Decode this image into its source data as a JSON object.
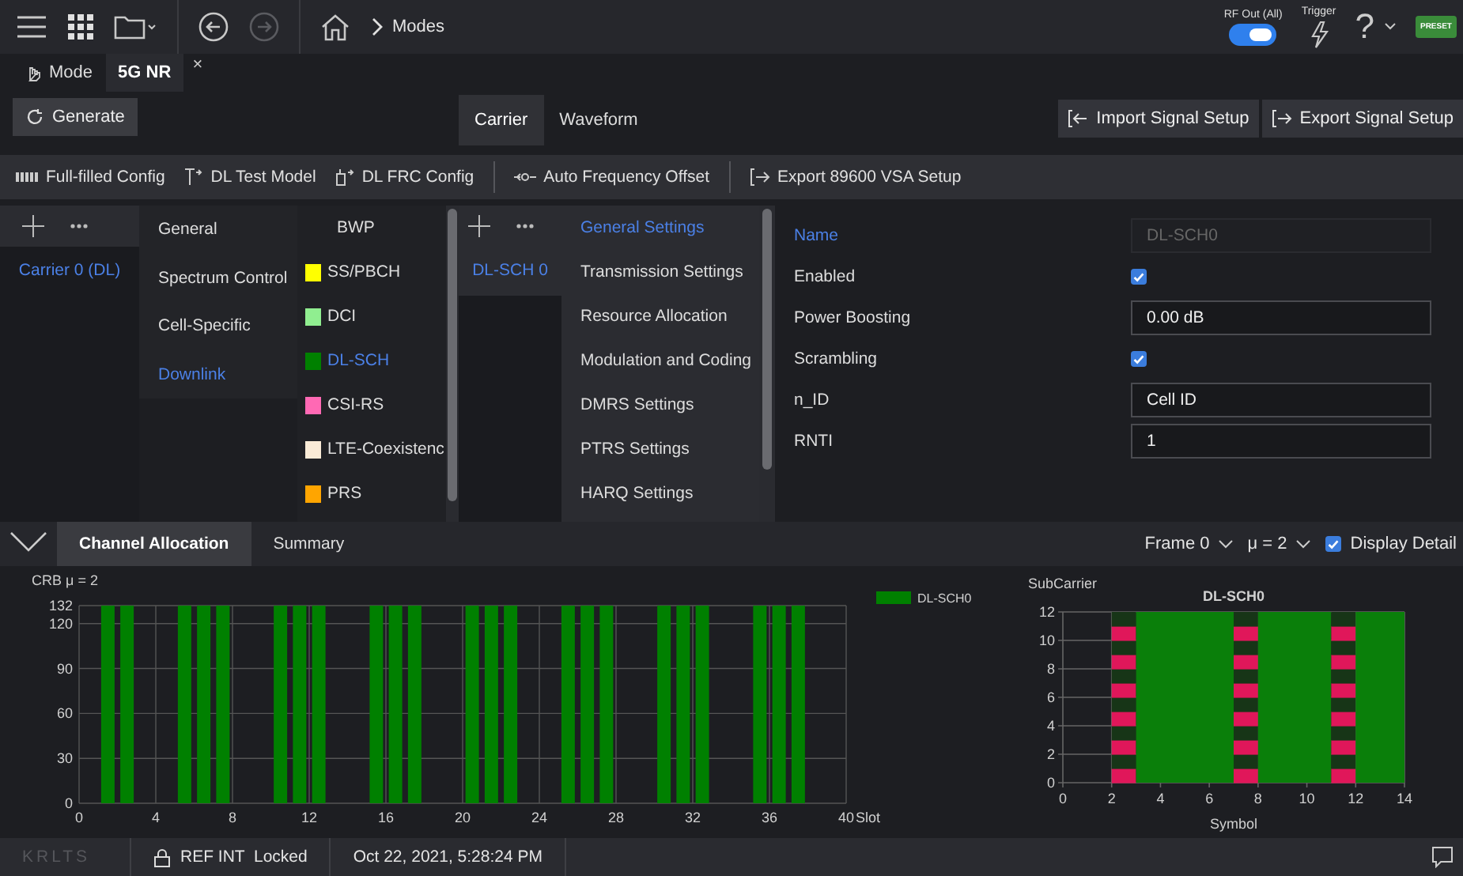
{
  "top_bar": {
    "breadcrumb": "Modes",
    "forward_disabled": true,
    "rf_out": {
      "label": "RF Out (All)",
      "on": true
    },
    "trigger": "Trigger",
    "help": "?",
    "preset": "PRESET"
  },
  "doc_tabs": [
    {
      "label": "Mode",
      "selected": false,
      "kind": "mode"
    },
    {
      "label": "5G NR",
      "selected": true,
      "kind": "document",
      "close": "×"
    }
  ],
  "generate": "Generate",
  "view_tabs": [
    {
      "label": "Carrier",
      "selected": true
    },
    {
      "label": "Waveform",
      "selected": false
    }
  ],
  "setup_buttons": [
    {
      "label": "Import Signal Setup",
      "kind": "import"
    },
    {
      "label": "Export Signal Setup",
      "kind": "export"
    }
  ],
  "toolbar_groups": [
    [
      {
        "label": "Full-filled Config",
        "kind": "bars"
      },
      {
        "label": "DL Test Model",
        "kind": "antenna"
      },
      {
        "label": "DL FRC Config",
        "kind": "device"
      }
    ],
    [
      {
        "label": "Auto Frequency Offset",
        "kind": "offset"
      }
    ],
    [
      {
        "label": "Export 89600 VSA Setup",
        "kind": "export"
      }
    ]
  ],
  "carriers": [
    {
      "label": "Carrier 0 (DL)",
      "selected": true
    }
  ],
  "categories": [
    {
      "label": "General",
      "selected": false
    },
    {
      "label": "Spectrum Control",
      "selected": false
    },
    {
      "label": "Cell-Specific",
      "selected": false
    },
    {
      "label": "Downlink",
      "selected": true
    }
  ],
  "channels": [
    {
      "label": "BWP",
      "selected": false
    },
    {
      "label": "SS/PBCH",
      "color": "#ffff00",
      "selected": false
    },
    {
      "label": "DCI",
      "color": "#90ee90",
      "selected": false
    },
    {
      "label": "DL-SCH",
      "color": "#008000",
      "selected": true
    },
    {
      "label": "CSI-RS",
      "color": "#ff69b4",
      "selected": false
    },
    {
      "label": "LTE-Coexistenc",
      "color": "#faebd7",
      "selected": false
    },
    {
      "label": "PRS",
      "color": "#ffa500",
      "selected": false
    }
  ],
  "instances": [
    {
      "label": "DL-SCH 0",
      "selected": true
    }
  ],
  "sections": [
    {
      "label": "General Settings",
      "selected": true
    },
    {
      "label": "Transmission Settings",
      "selected": false
    },
    {
      "label": "Resource Allocation",
      "selected": false
    },
    {
      "label": "Modulation and Coding",
      "selected": false
    },
    {
      "label": "DMRS Settings",
      "selected": false
    },
    {
      "label": "PTRS Settings",
      "selected": false
    },
    {
      "label": "HARQ Settings",
      "selected": false
    }
  ],
  "fields": [
    {
      "label": "Name",
      "kind": "text",
      "value": "DL-SCH0",
      "disabled": true,
      "selected": true
    },
    {
      "label": "Enabled",
      "kind": "checkbox",
      "checked": true,
      "selected": false
    },
    {
      "label": "Power Boosting",
      "kind": "text",
      "value": "0.00 dB",
      "disabled": false,
      "selected": false
    },
    {
      "label": "Scrambling",
      "kind": "checkbox",
      "checked": true,
      "selected": false
    },
    {
      "label": "n_ID",
      "kind": "text",
      "value": "Cell ID",
      "disabled": false,
      "selected": false
    },
    {
      "label": "RNTI",
      "kind": "text",
      "value": "1",
      "disabled": false,
      "selected": false
    }
  ],
  "bottom_tabs": [
    {
      "label": "Channel Allocation",
      "selected": true
    },
    {
      "label": "Summary",
      "selected": false
    }
  ],
  "frame": "Frame 0",
  "numerology": "μ = 2",
  "display_detail": {
    "label": "Display Detail",
    "checked": true
  },
  "allocation": {
    "chart_data": {
      "type": "bar",
      "ylabel": "CRB μ = 2",
      "xlabel": "Slot",
      "x": [
        1.5,
        2.5,
        5.5,
        6.5,
        7.5,
        10.5,
        11.5,
        12.5,
        15.5,
        16.5,
        17.5,
        20.5,
        21.5,
        22.5,
        25.5,
        26.5,
        27.5,
        30.5,
        31.5,
        32.5,
        35.5,
        36.5,
        37.5
      ],
      "series": [
        {
          "name": "DL-SCH0",
          "color": "#008000",
          "values": [
            132,
            132,
            132,
            132,
            132,
            132,
            132,
            132,
            132,
            132,
            132,
            132,
            132,
            132,
            132,
            132,
            132,
            132,
            132,
            132,
            132,
            132,
            132
          ]
        }
      ],
      "xlim": [
        0,
        40
      ],
      "ylim": [
        0,
        132
      ],
      "xticks": [
        0,
        4,
        8,
        12,
        16,
        20,
        24,
        28,
        32,
        36,
        40
      ],
      "yticks": [
        0,
        30,
        60,
        90,
        120,
        132
      ],
      "grid": true
    }
  },
  "resource_grid": {
    "title": "DL-SCH0",
    "ylabel": "SubCarrier",
    "xlabel": "Symbol",
    "xticks": [
      "0",
      "2",
      "4",
      "6",
      "8",
      "10",
      "12",
      "14"
    ],
    "yticks": [
      "12",
      "10",
      "8",
      "6",
      "4",
      "2",
      "0"
    ],
    "symbols": [
      {
        "kind": "none"
      },
      {
        "kind": "none"
      },
      {
        "kind": "dmrs"
      },
      {
        "kind": "data"
      },
      {
        "kind": "data"
      },
      {
        "kind": "data"
      },
      {
        "kind": "data"
      },
      {
        "kind": "dmrs"
      },
      {
        "kind": "data"
      },
      {
        "kind": "data"
      },
      {
        "kind": "data"
      },
      {
        "kind": "dmrs"
      },
      {
        "kind": "data"
      },
      {
        "kind": "data"
      }
    ]
  },
  "status_bar": {
    "instrument": "KRLTS",
    "reference": "REF INT  Locked",
    "datetime": "Oct 22, 2021, 5:28:24 PM"
  }
}
